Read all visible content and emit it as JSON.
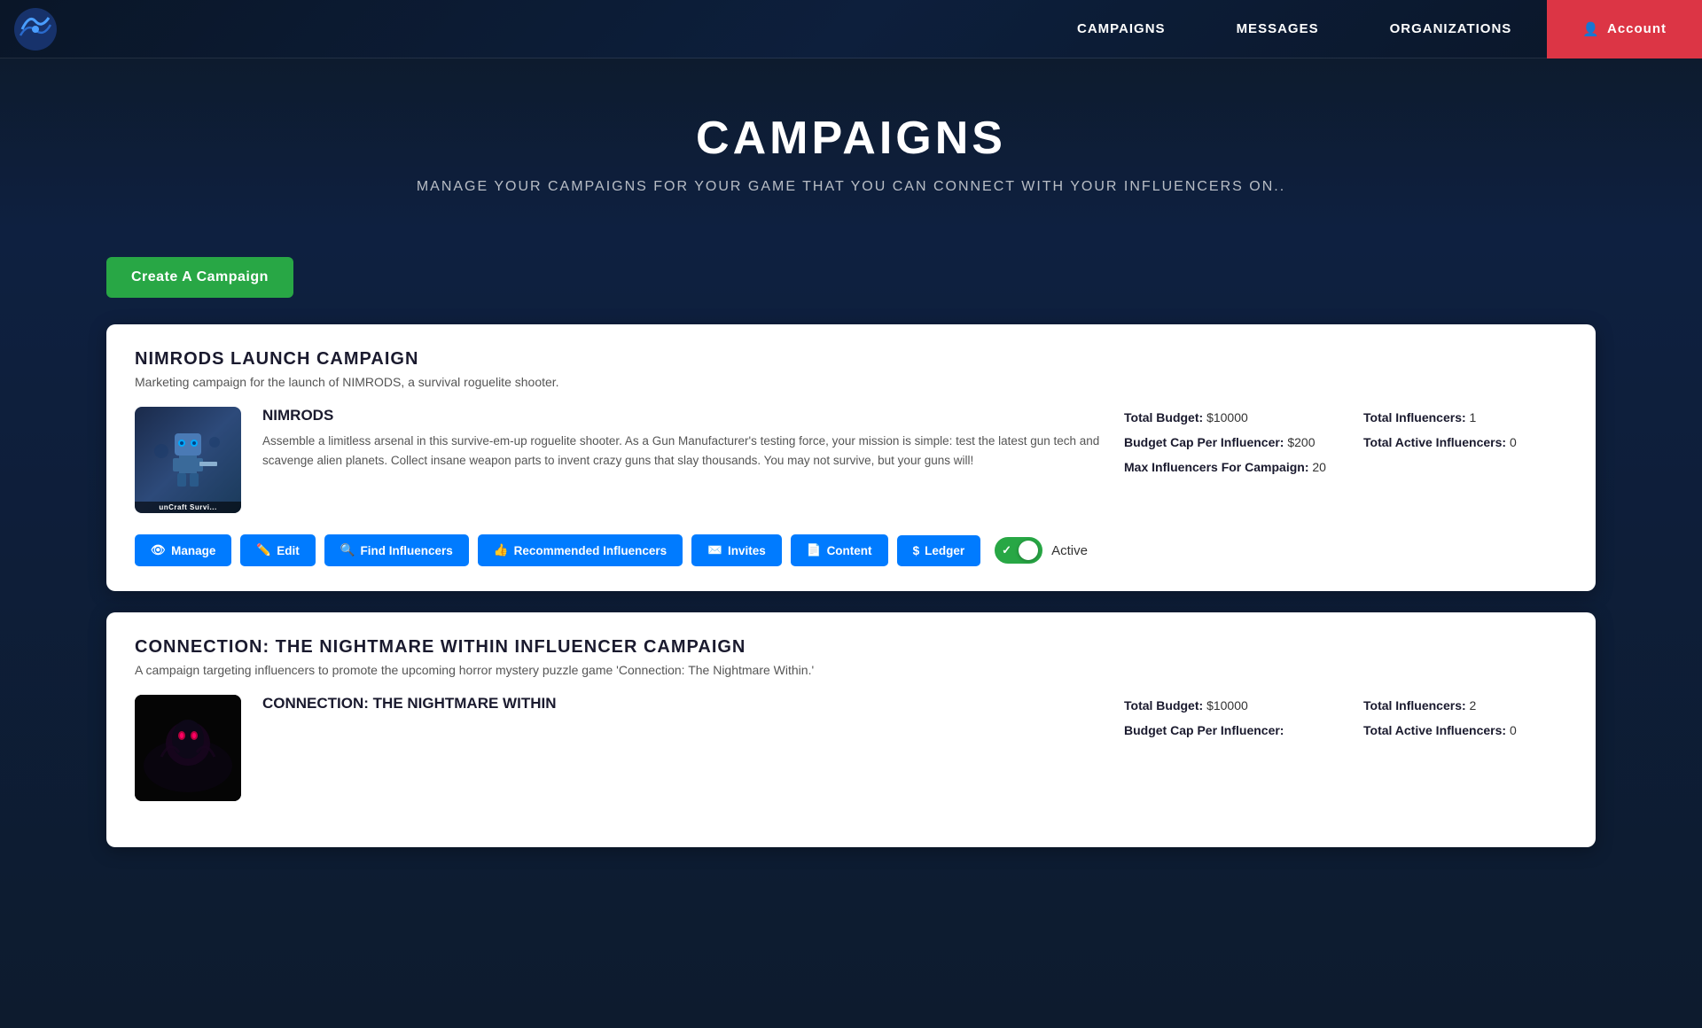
{
  "nav": {
    "campaigns_label": "CAMPAIGNS",
    "messages_label": "MESSAGES",
    "organizations_label": "ORGANIZATIONS",
    "account_label": "Account"
  },
  "hero": {
    "title": "CAMPAIGNS",
    "subtitle": "MANAGE YOUR CAMPAIGNS FOR YOUR GAME THAT YOU CAN CONNECT WITH YOUR INFLUENCERS ON.."
  },
  "create_button_label": "Create A Campaign",
  "campaigns": [
    {
      "title": "NIMRODS LAUNCH CAMPAIGN",
      "description": "Marketing campaign for the launch of NIMRODS, a survival roguelite shooter.",
      "game": {
        "name": "NIMRODS",
        "description": "Assemble a limitless arsenal in this survive-em-up roguelite shooter. As a Gun Manufacturer's testing force, your mission is simple: test the latest gun tech and scavenge alien planets. Collect insane weapon parts to invent crazy guns that slay thousands. You may not survive, but your guns will!"
      },
      "stats": {
        "total_budget_label": "Total Budget:",
        "total_budget_value": "$10000",
        "budget_cap_label": "Budget Cap Per Influencer:",
        "budget_cap_value": "$200",
        "max_influencers_label": "Max Influencers For Campaign:",
        "max_influencers_value": "20",
        "total_influencers_label": "Total Influencers:",
        "total_influencers_value": "1",
        "total_active_label": "Total Active Influencers:",
        "total_active_value": "0"
      },
      "actions": {
        "manage": "Manage",
        "edit": "Edit",
        "find_influencers": "Find Influencers",
        "recommended_influencers": "Recommended Influencers",
        "invites": "Invites",
        "content": "Content",
        "ledger": "Ledger",
        "active_label": "Active"
      },
      "is_active": true
    },
    {
      "title": "CONNECTION: THE NIGHTMARE WITHIN INFLUENCER CAMPAIGN",
      "description": "A campaign targeting influencers to promote the upcoming horror mystery puzzle game 'Connection: The Nightmare Within.'",
      "game": {
        "name": "CONNECTION: THE NIGHTMARE WITHIN",
        "description": ""
      },
      "stats": {
        "total_budget_label": "Total Budget:",
        "total_budget_value": "$10000",
        "budget_cap_label": "Budget Cap Per Influencer:",
        "budget_cap_value": "",
        "max_influencers_label": "",
        "max_influencers_value": "",
        "total_influencers_label": "Total Influencers:",
        "total_influencers_value": "2",
        "total_active_label": "Total Active Influencers:",
        "total_active_value": "0"
      }
    }
  ],
  "icons": {
    "user_icon": "👤",
    "eye_icon": "👁",
    "edit_icon": "✏️",
    "search_icon": "🔍",
    "thumb_icon": "👍",
    "mail_icon": "✉️",
    "file_icon": "📄",
    "dollar_icon": "$",
    "check_icon": "✓"
  }
}
